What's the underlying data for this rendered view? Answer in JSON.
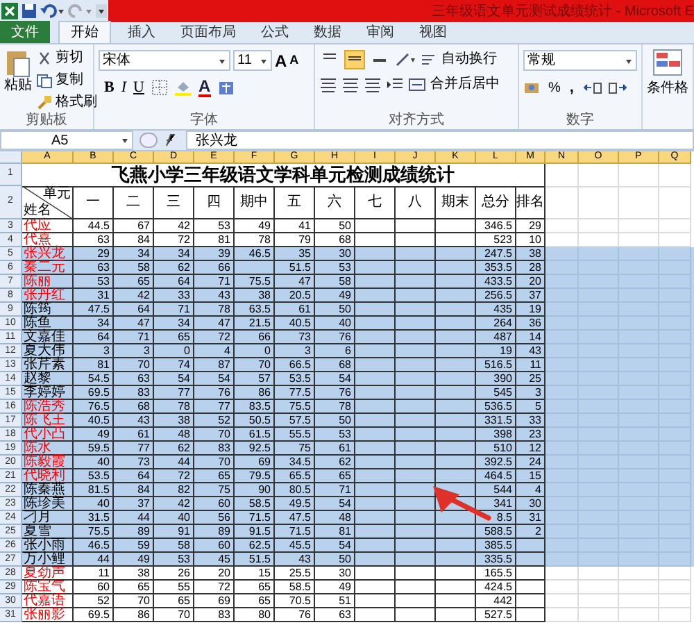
{
  "window": {
    "title": "三年级语文单元测试成绩统计 - Microsoft E"
  },
  "menu_tabs": [
    {
      "label": "文件",
      "kind": "file",
      "selected": false
    },
    {
      "label": "开始",
      "kind": "tab",
      "selected": true
    },
    {
      "label": "插入",
      "kind": "tab",
      "selected": false
    },
    {
      "label": "页面布局",
      "kind": "tab",
      "selected": false
    },
    {
      "label": "公式",
      "kind": "tab",
      "selected": false
    },
    {
      "label": "数据",
      "kind": "tab",
      "selected": false
    },
    {
      "label": "审阅",
      "kind": "tab",
      "selected": false
    },
    {
      "label": "视图",
      "kind": "tab",
      "selected": false
    }
  ],
  "ribbon": {
    "clipboard": {
      "label": "剪贴板",
      "paste": "粘贴",
      "cut": "剪切",
      "copy": "复制",
      "format_painter": "格式刷"
    },
    "font": {
      "label": "字体",
      "font_name": "宋体",
      "font_size": "11",
      "grow": "A",
      "shrink": "A",
      "bold": "B",
      "italic": "I",
      "underline": "U",
      "font_color": "A"
    },
    "alignment": {
      "label": "对齐方式",
      "vertical": [
        {
          "selected": false
        },
        {
          "selected": true
        },
        {
          "selected": false
        }
      ],
      "wrap_text": "自动换行",
      "merge_center": "合并后居中"
    },
    "number": {
      "label": "数字",
      "format": "常规",
      "percent": "%",
      "comma": ","
    },
    "styles": {
      "conditional_formatting": "条件格"
    }
  },
  "formula_bar": {
    "name_box": "A5",
    "formula": "张兴龙"
  },
  "sheet": {
    "columns": [
      {
        "label": "A",
        "selected": true
      },
      {
        "label": "B",
        "selected": true
      },
      {
        "label": "C",
        "selected": true
      },
      {
        "label": "D",
        "selected": true
      },
      {
        "label": "E",
        "selected": true
      },
      {
        "label": "F",
        "selected": true
      },
      {
        "label": "G",
        "selected": true
      },
      {
        "label": "H",
        "selected": true
      },
      {
        "label": "I",
        "selected": true
      },
      {
        "label": "J",
        "selected": true
      },
      {
        "label": "K",
        "selected": true
      },
      {
        "label": "L",
        "selected": true
      },
      {
        "label": "M",
        "selected": true
      },
      {
        "label": "N",
        "selected": true
      },
      {
        "label": "O",
        "selected": true
      },
      {
        "label": "P",
        "selected": true
      },
      {
        "label": "Q",
        "selected": true
      }
    ],
    "title_row": {
      "number": "1",
      "title": "飞燕小学三年级语文学科单元检测成绩统计"
    },
    "header_row": {
      "number": "2",
      "corner_top": "单元",
      "corner_bottom": "姓名",
      "headers": [
        "一",
        "二",
        "三",
        "四",
        "期中",
        "五",
        "六",
        "七",
        "八",
        "期末",
        "总分",
        "排名"
      ]
    },
    "rows": [
      {
        "number": "3",
        "name": "代应",
        "color": "#ff0000",
        "selected": false,
        "scores": {
          "unit_1": "44.5",
          "unit_2": "67",
          "unit_3": "42",
          "unit_4": "53",
          "midterm": "49",
          "unit_5": "41",
          "unit_6": "50"
        },
        "total": "346.5",
        "rank": "29"
      },
      {
        "number": "4",
        "name": "代熹",
        "color": "#ff0000",
        "selected": false,
        "scores": {
          "unit_1": "63",
          "unit_2": "84",
          "unit_3": "72",
          "unit_4": "81",
          "midterm": "78",
          "unit_5": "79",
          "unit_6": "68"
        },
        "total": "523",
        "rank": "10"
      },
      {
        "number": "5",
        "name": "张兴龙",
        "color": "#ff0000",
        "selected": true,
        "scores": {
          "unit_1": "29",
          "unit_2": "34",
          "unit_3": "34",
          "unit_4": "39",
          "midterm": "46.5",
          "unit_5": "35",
          "unit_6": "30"
        },
        "total": "247.5",
        "rank": "38"
      },
      {
        "number": "6",
        "name": "秦二元",
        "color": "#ff0000",
        "selected": true,
        "scores": {
          "unit_1": "63",
          "unit_2": "58",
          "unit_3": "62",
          "unit_4": "66",
          "unit_5": "51.5",
          "unit_6": "53"
        },
        "total": "353.5",
        "rank": "28"
      },
      {
        "number": "7",
        "name": "陈丽",
        "color": "#ff0000",
        "selected": true,
        "scores": {
          "unit_1": "53",
          "unit_2": "65",
          "unit_3": "64",
          "unit_4": "71",
          "midterm": "75.5",
          "unit_5": "47",
          "unit_6": "58"
        },
        "total": "433.5",
        "rank": "20"
      },
      {
        "number": "8",
        "name": "张丹红",
        "color": "#ff0000",
        "selected": true,
        "scores": {
          "unit_1": "31",
          "unit_2": "42",
          "unit_3": "33",
          "unit_4": "43",
          "midterm": "38",
          "unit_5": "20.5",
          "unit_6": "49"
        },
        "total": "256.5",
        "rank": "37"
      },
      {
        "number": "9",
        "name": "陈筠",
        "color": "#000000",
        "selected": true,
        "scores": {
          "unit_1": "47.5",
          "unit_2": "64",
          "unit_3": "71",
          "unit_4": "78",
          "midterm": "63.5",
          "unit_5": "61",
          "unit_6": "50"
        },
        "total": "435",
        "rank": "19"
      },
      {
        "number": "10",
        "name": "陈鱼",
        "color": "#000000",
        "selected": true,
        "scores": {
          "unit_1": "34",
          "unit_2": "47",
          "unit_3": "34",
          "unit_4": "47",
          "midterm": "21.5",
          "unit_5": "40.5",
          "unit_6": "40"
        },
        "total": "264",
        "rank": "36"
      },
      {
        "number": "11",
        "name": "文嘉佳",
        "color": "#000000",
        "selected": true,
        "scores": {
          "unit_1": "64",
          "unit_2": "71",
          "unit_3": "65",
          "unit_4": "72",
          "midterm": "66",
          "unit_5": "73",
          "unit_6": "76"
        },
        "total": "487",
        "rank": "14"
      },
      {
        "number": "12",
        "name": "夏大伟",
        "color": "#000000",
        "selected": true,
        "scores": {
          "unit_1": "3",
          "unit_2": "3",
          "unit_3": "0",
          "unit_4": "4",
          "midterm": "0",
          "unit_5": "3",
          "unit_6": "6"
        },
        "total": "19",
        "rank": "43"
      },
      {
        "number": "13",
        "name": "张芹素",
        "color": "#000000",
        "selected": true,
        "scores": {
          "unit_1": "81",
          "unit_2": "70",
          "unit_3": "74",
          "unit_4": "87",
          "midterm": "70",
          "unit_5": "66.5",
          "unit_6": "68"
        },
        "total": "516.5",
        "rank": "11"
      },
      {
        "number": "14",
        "name": "赵黎",
        "color": "#000000",
        "selected": true,
        "scores": {
          "unit_1": "54.5",
          "unit_2": "63",
          "unit_3": "54",
          "unit_4": "54",
          "midterm": "57",
          "unit_5": "53.5",
          "unit_6": "54"
        },
        "total": "390",
        "rank": "25"
      },
      {
        "number": "15",
        "name": "李婷婷",
        "color": "#000000",
        "selected": true,
        "scores": {
          "unit_1": "69.5",
          "unit_2": "83",
          "unit_3": "77",
          "unit_4": "76",
          "midterm": "86",
          "unit_5": "77.5",
          "unit_6": "76"
        },
        "total": "545",
        "rank": "3"
      },
      {
        "number": "16",
        "name": "陈浩秀",
        "color": "#ff0000",
        "selected": true,
        "scores": {
          "unit_1": "76.5",
          "unit_2": "68",
          "unit_3": "78",
          "unit_4": "77",
          "midterm": "83.5",
          "unit_5": "75.5",
          "unit_6": "78"
        },
        "total": "536.5",
        "rank": "5"
      },
      {
        "number": "17",
        "name": "陈飞王",
        "color": "#ff0000",
        "selected": true,
        "scores": {
          "unit_1": "40.5",
          "unit_2": "43",
          "unit_3": "38",
          "unit_4": "52",
          "midterm": "50.5",
          "unit_5": "57.5",
          "unit_6": "50"
        },
        "total": "331.5",
        "rank": "33"
      },
      {
        "number": "18",
        "name": "代小凸",
        "color": "#ff0000",
        "selected": true,
        "scores": {
          "unit_1": "49",
          "unit_2": "61",
          "unit_3": "48",
          "unit_4": "70",
          "midterm": "61.5",
          "unit_5": "55.5",
          "unit_6": "53"
        },
        "total": "398",
        "rank": "23"
      },
      {
        "number": "19",
        "name": "陈水",
        "color": "#ff0000",
        "selected": true,
        "scores": {
          "unit_1": "59.5",
          "unit_2": "77",
          "unit_3": "62",
          "unit_4": "83",
          "midterm": "92.5",
          "unit_5": "75",
          "unit_6": "61"
        },
        "total": "510",
        "rank": "12"
      },
      {
        "number": "20",
        "name": "陈毅霞",
        "color": "#ff0000",
        "selected": true,
        "scores": {
          "unit_1": "40",
          "unit_2": "73",
          "unit_3": "44",
          "unit_4": "70",
          "midterm": "69",
          "unit_5": "34.5",
          "unit_6": "62"
        },
        "total": "392.5",
        "rank": "24"
      },
      {
        "number": "21",
        "name": "代晓利",
        "color": "#ff0000",
        "selected": true,
        "scores": {
          "unit_1": "53.5",
          "unit_2": "64",
          "unit_3": "72",
          "unit_4": "65",
          "midterm": "79.5",
          "unit_5": "65.5",
          "unit_6": "65"
        },
        "total": "464.5",
        "rank": "15"
      },
      {
        "number": "22",
        "name": "陈秦燕",
        "color": "#000000",
        "selected": true,
        "scores": {
          "unit_1": "81.5",
          "unit_2": "84",
          "unit_3": "82",
          "unit_4": "75",
          "midterm": "90",
          "unit_5": "80.5",
          "unit_6": "71"
        },
        "total": "544",
        "rank": "4"
      },
      {
        "number": "23",
        "name": "陈珍美",
        "color": "#000000",
        "selected": true,
        "scores": {
          "unit_1": "40",
          "unit_2": "37",
          "unit_3": "42",
          "unit_4": "60",
          "midterm": "58.5",
          "unit_5": "49.5",
          "unit_6": "54"
        },
        "total": "341",
        "rank": "30"
      },
      {
        "number": "24",
        "name": "刁月",
        "color": "#000000",
        "selected": true,
        "scores": {
          "unit_1": "31.5",
          "unit_2": "44",
          "unit_3": "40",
          "unit_4": "56",
          "midterm": "71.5",
          "unit_5": "47.5",
          "unit_6": "48"
        },
        "total": "8.5",
        "rank": "31"
      },
      {
        "number": "25",
        "name": "夏雪",
        "color": "#000000",
        "selected": true,
        "scores": {
          "unit_1": "75.5",
          "unit_2": "89",
          "unit_3": "91",
          "unit_4": "89",
          "midterm": "91.5",
          "unit_5": "71.5",
          "unit_6": "81"
        },
        "total": "588.5",
        "rank": "2"
      },
      {
        "number": "26",
        "name": "张小雨",
        "color": "#000000",
        "selected": true,
        "scores": {
          "unit_1": "46.5",
          "unit_2": "59",
          "unit_3": "58",
          "unit_4": "60",
          "midterm": "62.5",
          "unit_5": "45.5",
          "unit_6": "54"
        },
        "total": "385.5"
      },
      {
        "number": "27",
        "name": "万小鲤",
        "color": "#000000",
        "selected": true,
        "scores": {
          "unit_1": "44",
          "unit_2": "49",
          "unit_3": "53",
          "unit_4": "45",
          "midterm": "51.5",
          "unit_5": "43",
          "unit_6": "50"
        },
        "total": "335.5"
      },
      {
        "number": "28",
        "name": "夏劲声",
        "color": "#ff0000",
        "selected": false,
        "scores": {
          "unit_1": "11",
          "unit_2": "38",
          "unit_3": "26",
          "unit_4": "20",
          "midterm": "15",
          "unit_5": "25.5",
          "unit_6": "30"
        },
        "total": "165.5"
      },
      {
        "number": "29",
        "name": "陈宝气",
        "color": "#ff0000",
        "selected": false,
        "scores": {
          "unit_1": "60",
          "unit_2": "65",
          "unit_3": "55",
          "unit_4": "72",
          "midterm": "65",
          "unit_5": "58.5",
          "unit_6": "49"
        },
        "total": "424.5"
      },
      {
        "number": "30",
        "name": "代嘉语",
        "color": "#ff0000",
        "selected": false,
        "scores": {
          "unit_1": "52",
          "unit_2": "70",
          "unit_3": "65",
          "unit_4": "69",
          "midterm": "65",
          "unit_5": "70.5",
          "unit_6": "51"
        },
        "total": "442"
      },
      {
        "number": "31",
        "name": "张丽影",
        "color": "#ff0000",
        "selected": false,
        "scores": {
          "unit_1": "69.5",
          "unit_2": "86",
          "unit_3": "70",
          "unit_4": "83",
          "midterm": "80",
          "unit_5": "76",
          "unit_6": "63"
        },
        "total": "527.5"
      }
    ]
  }
}
